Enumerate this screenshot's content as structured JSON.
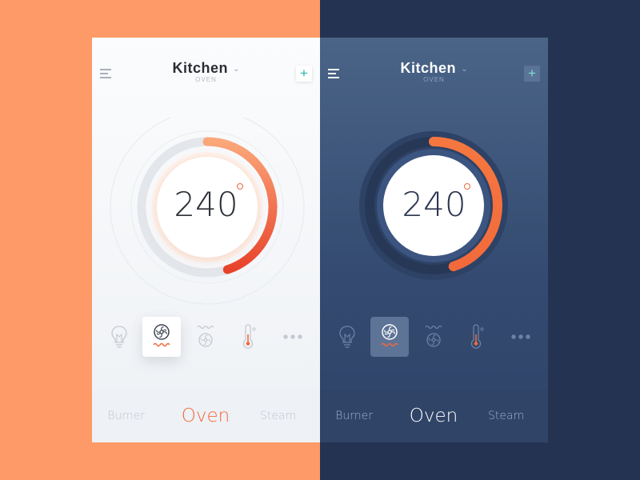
{
  "colors": {
    "left_background": "#fe9a67",
    "right_background": "#253352",
    "accent": "#f26a3c",
    "add_button_accent": "#27b5a8"
  },
  "panels": [
    {
      "theme": "light",
      "header": {
        "title": "Kitchen",
        "subtitle": "OVEN",
        "menu_icon": "hamburger-menu-icon",
        "dropdown_icon": "chevron-down-icon",
        "add_label": "+"
      },
      "dial": {
        "temperature": "240",
        "degree_icon": "degree-circle-icon",
        "fill_fraction": 0.45
      },
      "modes": [
        {
          "icon": "lightbulb-icon",
          "active": false
        },
        {
          "icon": "fan-oven-icon",
          "active": true
        },
        {
          "icon": "fan-top-heat-icon",
          "active": false
        },
        {
          "icon": "thermometer-icon",
          "active": false
        },
        {
          "icon": "more-dots-icon",
          "active": false
        }
      ],
      "tabs": {
        "left": "Burner",
        "selected": "Oven",
        "right": "Steam"
      }
    },
    {
      "theme": "dark",
      "header": {
        "title": "Kitchen",
        "subtitle": "OVEN",
        "menu_icon": "hamburger-menu-icon",
        "dropdown_icon": "chevron-down-icon",
        "add_label": "+"
      },
      "dial": {
        "temperature": "240",
        "degree_icon": "degree-circle-icon",
        "fill_fraction": 0.45
      },
      "modes": [
        {
          "icon": "lightbulb-icon",
          "active": false
        },
        {
          "icon": "fan-oven-icon",
          "active": true
        },
        {
          "icon": "fan-top-heat-icon",
          "active": false
        },
        {
          "icon": "thermometer-icon",
          "active": false
        },
        {
          "icon": "more-dots-icon",
          "active": false
        }
      ],
      "tabs": {
        "left": "Burner",
        "selected": "Oven",
        "right": "Steam"
      }
    }
  ]
}
